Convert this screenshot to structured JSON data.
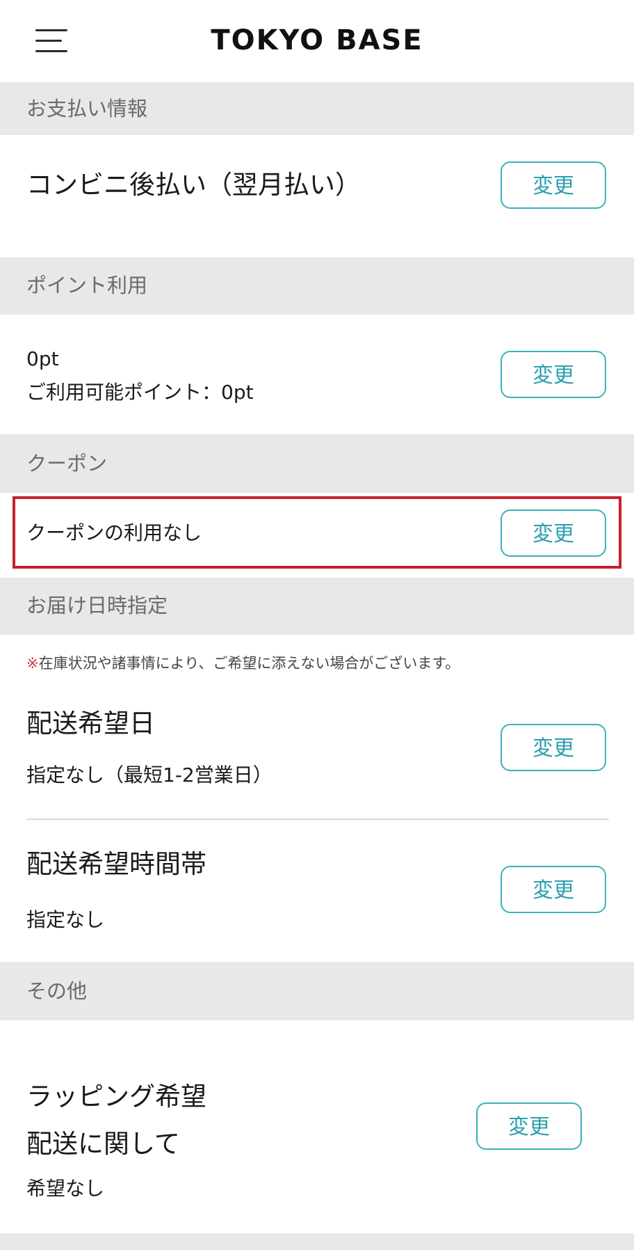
{
  "header": {
    "title": "TOKYO BASE"
  },
  "sections": {
    "payment": {
      "header": "お支払い情報",
      "method": "コンビニ後払い（翌月払い）",
      "button": "変更"
    },
    "points": {
      "header": "ポイント利用",
      "value": "0pt",
      "available": "ご利用可能ポイント：0pt",
      "button": "変更"
    },
    "coupon": {
      "header": "クーポン",
      "value": "クーポンの利用なし",
      "button": "変更"
    },
    "delivery": {
      "header": "お届け日時指定",
      "note_mark": "※",
      "note": "在庫状況や諸事情により、ご希望に添えない場合がございます。",
      "date": {
        "label": "配送希望日",
        "value": "指定なし（最短1-2営業日）",
        "button": "変更"
      },
      "time": {
        "label": "配送希望時間帯",
        "value": "指定なし",
        "button": "変更"
      }
    },
    "other": {
      "header": "その他",
      "wrapping": "ラッピング希望",
      "shipping_label": "配送に関して",
      "value": "希望なし",
      "button": "変更"
    }
  },
  "colors": {
    "accent": "#3bb0bd",
    "highlight": "#c8202e",
    "section_bg": "#e8e8e8"
  }
}
